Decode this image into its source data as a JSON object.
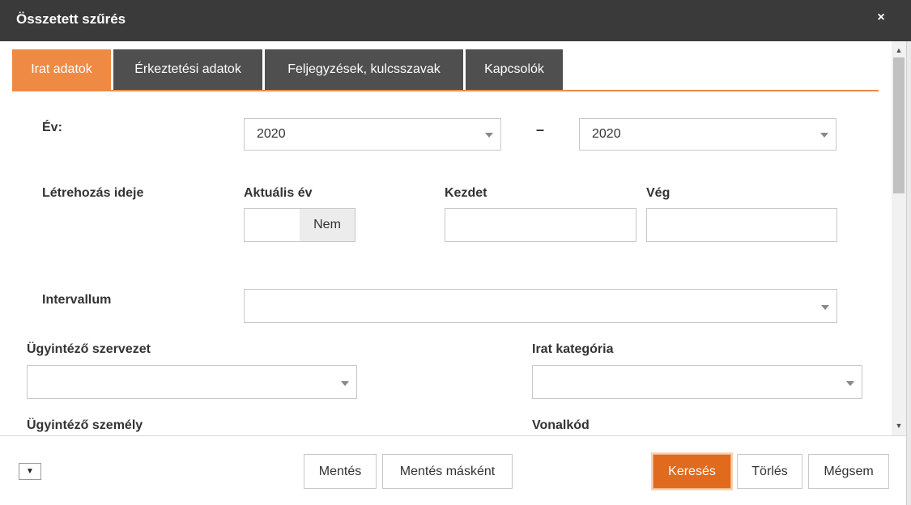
{
  "dialog": {
    "title": "Összetett szűrés",
    "close_symbol": "×"
  },
  "tabs": [
    {
      "label": "Irat adatok",
      "active": true
    },
    {
      "label": "Érkeztetési adatok",
      "active": false
    },
    {
      "label": "Feljegyzések, kulcsszavak",
      "active": false
    },
    {
      "label": "Kapcsolók",
      "active": false
    }
  ],
  "form": {
    "ev": {
      "label": "Év:",
      "from_value": "2020",
      "separator": "–",
      "to_value": "2020"
    },
    "letrehozas": {
      "label": "Létrehozás ideje",
      "aktualis_ev_label": "Aktuális év",
      "toggle_value": "Nem",
      "kezdet_label": "Kezdet",
      "veg_label": "Vég"
    },
    "intervallum": {
      "label": "Intervallum",
      "value": ""
    },
    "ugyintezo_szervezet": {
      "label": "Ügyintéző szervezet",
      "value": ""
    },
    "irat_kategoria": {
      "label": "Irat kategória",
      "value": ""
    },
    "ugyintezo_szemely": {
      "label": "Ügyintéző személy"
    },
    "vonalkod": {
      "label": "Vonalkód"
    }
  },
  "footer": {
    "options_symbol": "▼",
    "save_label": "Mentés",
    "save_as_label": "Mentés másként",
    "search_label": "Keresés",
    "clear_label": "Törlés",
    "cancel_label": "Mégsem"
  },
  "scrollbar": {
    "up_symbol": "▲",
    "down_symbol": "▼"
  },
  "colors": {
    "accent": "#ef8a44",
    "primary_button": "#e06a1e",
    "titlebar": "#3a3a3a",
    "tab_inactive": "#4f4f4f"
  }
}
